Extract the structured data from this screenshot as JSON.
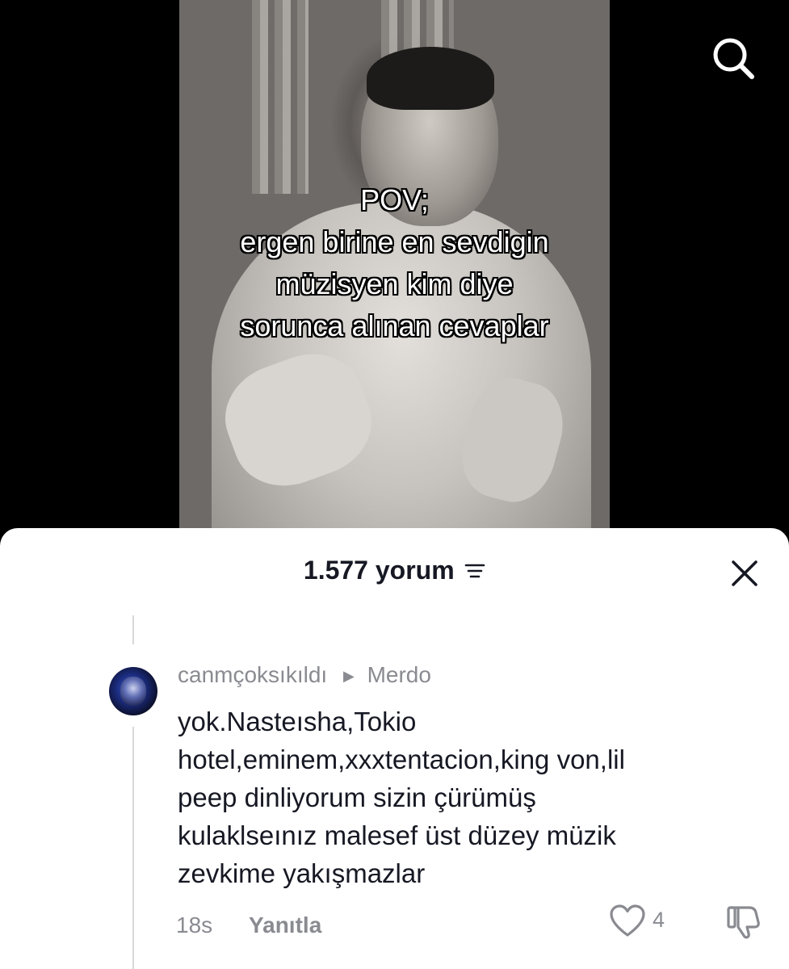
{
  "video": {
    "overlay_lines": [
      "POV;",
      "ergen birine en sevdigin",
      "müzisyen kim diye",
      "sorunca alınan cevaplar"
    ]
  },
  "comments_sheet": {
    "count_label": "1.577 yorum",
    "comment": {
      "username": "canmçoksıkıldı",
      "reply_to": "Merdo",
      "text_lines": [
        "yok.Nasteısha,Tokio",
        "hotel,eminem,xxxtentacion,king von,lil",
        "peep dinliyorum sizin çürümüş",
        "kulaklseınız malesef üst düzey müzik",
        "zevkime yakışmazlar"
      ],
      "time": "18s",
      "reply_label": "Yanıtla",
      "like_count": "4"
    }
  },
  "icons": {
    "search": "search-icon",
    "sort": "sort-icon",
    "close": "close-icon",
    "like": "heart-icon",
    "dislike": "thumbs-down-icon",
    "reply_arrow": "triangle-right-icon"
  },
  "colors": {
    "sheet_background": "#ffffff",
    "primary_text": "#161823",
    "secondary_text": "#8a8b91"
  }
}
